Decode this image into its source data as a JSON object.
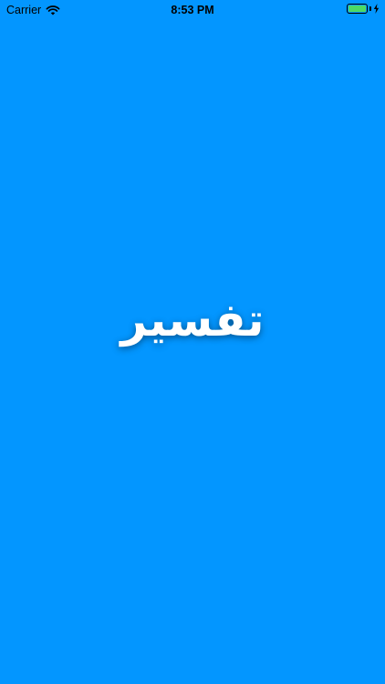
{
  "status_bar": {
    "carrier": "Carrier",
    "time": "8:53 PM",
    "wifi_icon": "wifi-icon",
    "battery_icon": "battery-icon",
    "charging_icon": "charging-bolt-icon",
    "battery_level": 1.0
  },
  "splash": {
    "title": "تفسير"
  },
  "colors": {
    "background": "#0396FF",
    "title": "#FFFFFF",
    "battery": "#4CD964"
  }
}
